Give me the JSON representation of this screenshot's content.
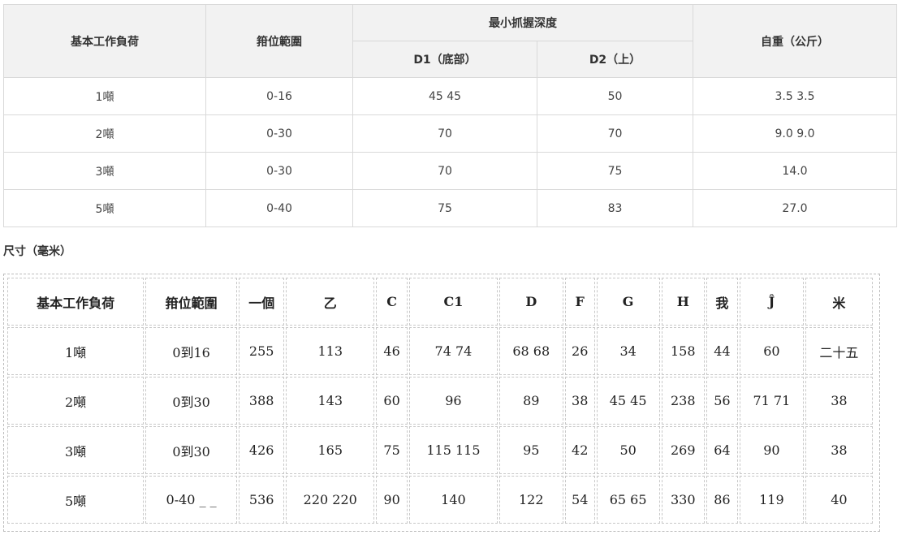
{
  "spec": {
    "header": {
      "load": "基本工作負荷",
      "range": "箝位範圍",
      "depth_group": "最小抓握深度",
      "d1": "D1（底部）",
      "d2": "D2（上）",
      "weight": "自重（公斤）"
    },
    "rows": [
      [
        "1噸",
        "0-16",
        "45 45",
        "50",
        "3.5 3.5"
      ],
      [
        "2噸",
        "0-30",
        "70",
        "70",
        "9.0 9.0"
      ],
      [
        "3噸",
        "0-30",
        "70",
        "75",
        "14.0"
      ],
      [
        "5噸",
        "0-40",
        "75",
        "83",
        "27.0"
      ]
    ]
  },
  "dimensions": {
    "caption": "尺寸（毫米）",
    "headers": [
      "基本工作負荷",
      "箝位範圍",
      "一個",
      "乙",
      "C",
      "C1",
      "D",
      "F",
      "G",
      "H",
      "我",
      "Ĵ",
      "米"
    ],
    "rows": [
      [
        "1噸",
        "0到16",
        "255",
        "113",
        "46",
        "74 74",
        "68 68",
        "26",
        "34",
        "158",
        "44",
        "60",
        "二十五"
      ],
      [
        "2噸",
        "0到30",
        "388",
        "143",
        "60",
        "96",
        "89",
        "38",
        "45 45",
        "238",
        "56",
        "71 71",
        "38"
      ],
      [
        "3噸",
        "0到30",
        "426",
        "165",
        "75",
        "115 115",
        "95",
        "42",
        "50",
        "269",
        "64",
        "90",
        "38"
      ],
      [
        "5噸",
        "0-40 _ _",
        "536",
        "220 220",
        "90",
        "140",
        "122",
        "54",
        "65 65",
        "330",
        "86",
        "119",
        "40"
      ]
    ]
  }
}
